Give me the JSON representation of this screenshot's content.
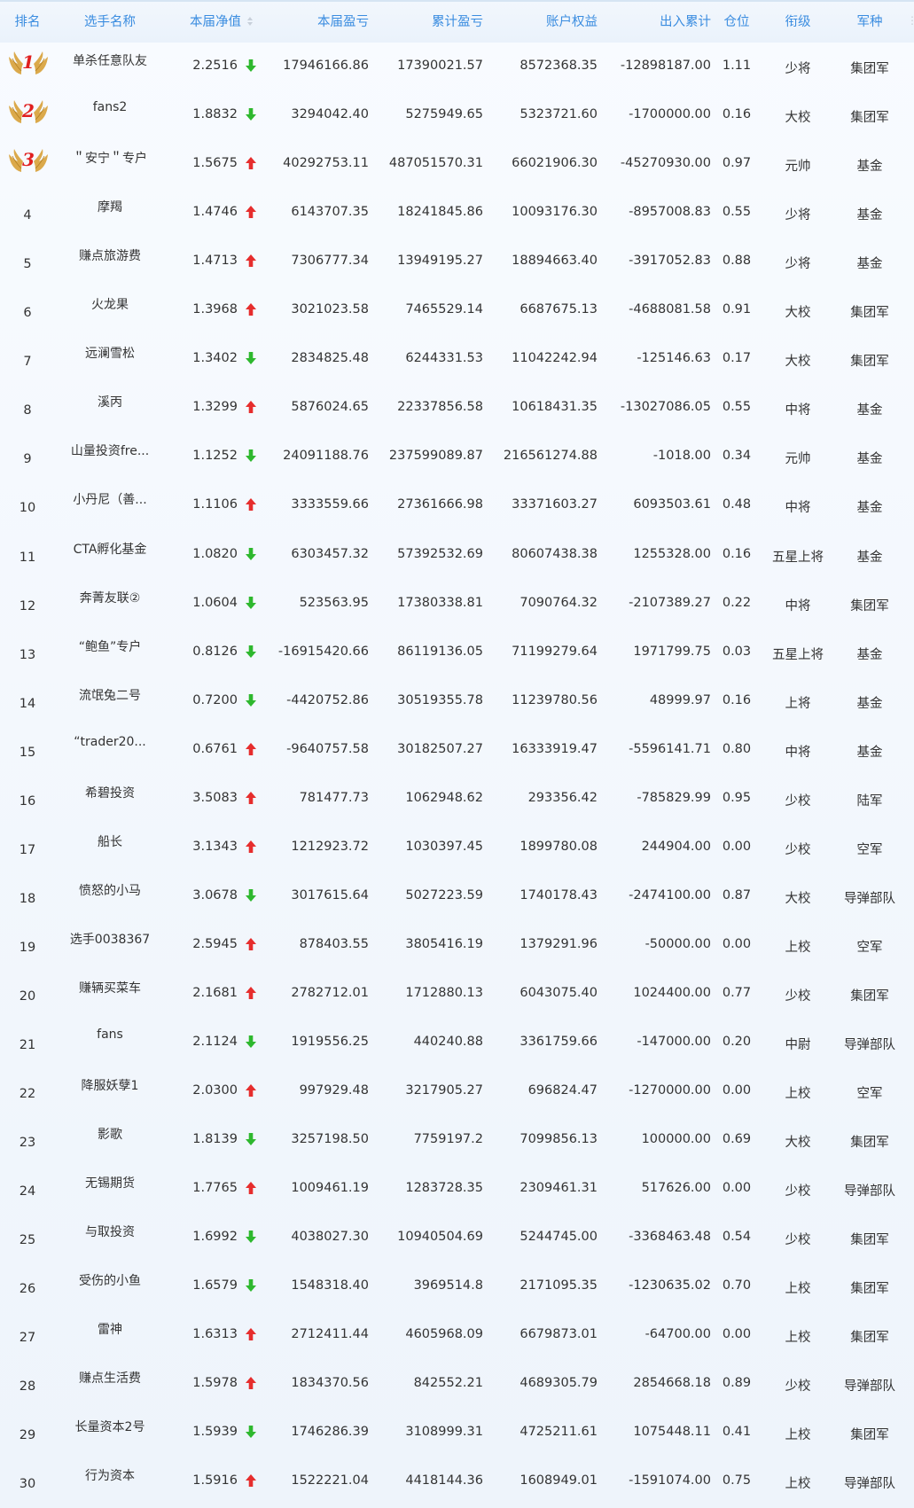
{
  "colors": {
    "header_text": "#3b8de0",
    "up": "#e62d2d",
    "down": "#2eb82e",
    "medal_num": "#e01f1f",
    "wing": "#d9a441"
  },
  "headers": [
    {
      "key": "rank",
      "label": "排名",
      "sortable": false
    },
    {
      "key": "name",
      "label": "选手名称",
      "sortable": false
    },
    {
      "key": "nav",
      "label": "本届净值",
      "sortable": true
    },
    {
      "key": "profit",
      "label": "本届盈亏",
      "sortable": false
    },
    {
      "key": "cum",
      "label": "累计盈亏",
      "sortable": false
    },
    {
      "key": "equity",
      "label": "账户权益",
      "sortable": false
    },
    {
      "key": "flow",
      "label": "出入累计",
      "sortable": false
    },
    {
      "key": "pos",
      "label": "仓位",
      "sortable": false
    },
    {
      "key": "rankname",
      "label": "衔级",
      "sortable": false
    },
    {
      "key": "army",
      "label": "军种",
      "sortable": false
    }
  ],
  "rows": [
    {
      "rank": "1",
      "medal": true,
      "name": "单杀任意队友",
      "nav": "2.2516",
      "trend": "down",
      "profit": "17946166.86",
      "cum": "17390021.57",
      "equity": "8572368.35",
      "flow": "-12898187.00",
      "pos": "1.11",
      "rankname": "少将",
      "army": "集团军"
    },
    {
      "rank": "2",
      "medal": true,
      "name": "fans2",
      "nav": "1.8832",
      "trend": "down",
      "profit": "3294042.40",
      "cum": "5275949.65",
      "equity": "5323721.60",
      "flow": "-1700000.00",
      "pos": "0.16",
      "rankname": "大校",
      "army": "集团军"
    },
    {
      "rank": "3",
      "medal": true,
      "name": "＂安宁＂专户",
      "nav": "1.5675",
      "trend": "up",
      "profit": "40292753.11",
      "cum": "487051570.31",
      "equity": "66021906.30",
      "flow": "-45270930.00",
      "pos": "0.97",
      "rankname": "元帅",
      "army": "基金"
    },
    {
      "rank": "4",
      "medal": false,
      "name": "摩羯",
      "nav": "1.4746",
      "trend": "up",
      "profit": "6143707.35",
      "cum": "18241845.86",
      "equity": "10093176.30",
      "flow": "-8957008.83",
      "pos": "0.55",
      "rankname": "少将",
      "army": "基金"
    },
    {
      "rank": "5",
      "medal": false,
      "name": "赚点旅游费",
      "nav": "1.4713",
      "trend": "up",
      "profit": "7306777.34",
      "cum": "13949195.27",
      "equity": "18894663.40",
      "flow": "-3917052.83",
      "pos": "0.88",
      "rankname": "少将",
      "army": "基金"
    },
    {
      "rank": "6",
      "medal": false,
      "name": "火龙果",
      "nav": "1.3968",
      "trend": "up",
      "profit": "3021023.58",
      "cum": "7465529.14",
      "equity": "6687675.13",
      "flow": "-4688081.58",
      "pos": "0.91",
      "rankname": "大校",
      "army": "集团军"
    },
    {
      "rank": "7",
      "medal": false,
      "name": "远澜雪松",
      "nav": "1.3402",
      "trend": "down",
      "profit": "2834825.48",
      "cum": "6244331.53",
      "equity": "11042242.94",
      "flow": "-125146.63",
      "pos": "0.17",
      "rankname": "大校",
      "army": "集团军"
    },
    {
      "rank": "8",
      "medal": false,
      "name": "溪丙",
      "nav": "1.3299",
      "trend": "up",
      "profit": "5876024.65",
      "cum": "22337856.58",
      "equity": "10618431.35",
      "flow": "-13027086.05",
      "pos": "0.55",
      "rankname": "中将",
      "army": "基金"
    },
    {
      "rank": "9",
      "medal": false,
      "name": "山量投资fre...",
      "nav": "1.1252",
      "trend": "down",
      "profit": "24091188.76",
      "cum": "237599089.87",
      "equity": "216561274.88",
      "flow": "-1018.00",
      "pos": "0.34",
      "rankname": "元帅",
      "army": "基金"
    },
    {
      "rank": "10",
      "medal": false,
      "name": "小丹尼（善...",
      "nav": "1.1106",
      "trend": "up",
      "profit": "3333559.66",
      "cum": "27361666.98",
      "equity": "33371603.27",
      "flow": "6093503.61",
      "pos": "0.48",
      "rankname": "中将",
      "army": "基金"
    },
    {
      "rank": "11",
      "medal": false,
      "name": "CTA孵化基金",
      "nav": "1.0820",
      "trend": "down",
      "profit": "6303457.32",
      "cum": "57392532.69",
      "equity": "80607438.38",
      "flow": "1255328.00",
      "pos": "0.16",
      "rankname": "五星上将",
      "army": "基金"
    },
    {
      "rank": "12",
      "medal": false,
      "name": "奔菁友联②",
      "nav": "1.0604",
      "trend": "down",
      "profit": "523563.95",
      "cum": "17380338.81",
      "equity": "7090764.32",
      "flow": "-2107389.27",
      "pos": "0.22",
      "rankname": "中将",
      "army": "集团军"
    },
    {
      "rank": "13",
      "medal": false,
      "name": "“鲍鱼”专户",
      "nav": "0.8126",
      "trend": "down",
      "profit": "-16915420.66",
      "cum": "86119136.05",
      "equity": "71199279.64",
      "flow": "1971799.75",
      "pos": "0.03",
      "rankname": "五星上将",
      "army": "基金"
    },
    {
      "rank": "14",
      "medal": false,
      "name": "流氓兔二号",
      "nav": "0.7200",
      "trend": "down",
      "profit": "-4420752.86",
      "cum": "30519355.78",
      "equity": "11239780.56",
      "flow": "48999.97",
      "pos": "0.16",
      "rankname": "上将",
      "army": "基金"
    },
    {
      "rank": "15",
      "medal": false,
      "name": "“trader20...",
      "nav": "0.6761",
      "trend": "up",
      "profit": "-9640757.58",
      "cum": "30182507.27",
      "equity": "16333919.47",
      "flow": "-5596141.71",
      "pos": "0.80",
      "rankname": "中将",
      "army": "基金"
    },
    {
      "rank": "16",
      "medal": false,
      "name": "希碧投资",
      "nav": "3.5083",
      "trend": "up",
      "profit": "781477.73",
      "cum": "1062948.62",
      "equity": "293356.42",
      "flow": "-785829.99",
      "pos": "0.95",
      "rankname": "少校",
      "army": "陆军"
    },
    {
      "rank": "17",
      "medal": false,
      "name": "船长",
      "nav": "3.1343",
      "trend": "up",
      "profit": "1212923.72",
      "cum": "1030397.45",
      "equity": "1899780.08",
      "flow": "244904.00",
      "pos": "0.00",
      "rankname": "少校",
      "army": "空军"
    },
    {
      "rank": "18",
      "medal": false,
      "name": "愤怒的小马",
      "nav": "3.0678",
      "trend": "down",
      "profit": "3017615.64",
      "cum": "5027223.59",
      "equity": "1740178.43",
      "flow": "-2474100.00",
      "pos": "0.87",
      "rankname": "大校",
      "army": "导弹部队"
    },
    {
      "rank": "19",
      "medal": false,
      "name": "选手0038367",
      "nav": "2.5945",
      "trend": "up",
      "profit": "878403.55",
      "cum": "3805416.19",
      "equity": "1379291.96",
      "flow": "-50000.00",
      "pos": "0.00",
      "rankname": "上校",
      "army": "空军"
    },
    {
      "rank": "20",
      "medal": false,
      "name": "赚辆买菜车",
      "nav": "2.1681",
      "trend": "up",
      "profit": "2782712.01",
      "cum": "1712880.13",
      "equity": "6043075.40",
      "flow": "1024400.00",
      "pos": "0.77",
      "rankname": "少校",
      "army": "集团军"
    },
    {
      "rank": "21",
      "medal": false,
      "name": "fans",
      "nav": "2.1124",
      "trend": "down",
      "profit": "1919556.25",
      "cum": "440240.88",
      "equity": "3361759.66",
      "flow": "-147000.00",
      "pos": "0.20",
      "rankname": "中尉",
      "army": "导弹部队"
    },
    {
      "rank": "22",
      "medal": false,
      "name": "降服妖孽1",
      "nav": "2.0300",
      "trend": "up",
      "profit": "997929.48",
      "cum": "3217905.27",
      "equity": "696824.47",
      "flow": "-1270000.00",
      "pos": "0.00",
      "rankname": "上校",
      "army": "空军"
    },
    {
      "rank": "23",
      "medal": false,
      "name": "影歌",
      "nav": "1.8139",
      "trend": "down",
      "profit": "3257198.50",
      "cum": "7759197.2",
      "equity": "7099856.13",
      "flow": "100000.00",
      "pos": "0.69",
      "rankname": "大校",
      "army": "集团军"
    },
    {
      "rank": "24",
      "medal": false,
      "name": "无锡期货",
      "nav": "1.7765",
      "trend": "up",
      "profit": "1009461.19",
      "cum": "1283728.35",
      "equity": "2309461.31",
      "flow": "517626.00",
      "pos": "0.00",
      "rankname": "少校",
      "army": "导弹部队"
    },
    {
      "rank": "25",
      "medal": false,
      "name": "与取投资",
      "nav": "1.6992",
      "trend": "down",
      "profit": "4038027.30",
      "cum": "10940504.69",
      "equity": "5244745.00",
      "flow": "-3368463.48",
      "pos": "0.54",
      "rankname": "少校",
      "army": "集团军"
    },
    {
      "rank": "26",
      "medal": false,
      "name": "受伤的小鱼",
      "nav": "1.6579",
      "trend": "down",
      "profit": "1548318.40",
      "cum": "3969514.8",
      "equity": "2171095.35",
      "flow": "-1230635.02",
      "pos": "0.70",
      "rankname": "上校",
      "army": "集团军"
    },
    {
      "rank": "27",
      "medal": false,
      "name": "雷神",
      "nav": "1.6313",
      "trend": "up",
      "profit": "2712411.44",
      "cum": "4605968.09",
      "equity": "6679873.01",
      "flow": "-64700.00",
      "pos": "0.00",
      "rankname": "上校",
      "army": "集团军"
    },
    {
      "rank": "28",
      "medal": false,
      "name": "赚点生活费",
      "nav": "1.5978",
      "trend": "up",
      "profit": "1834370.56",
      "cum": "842552.21",
      "equity": "4689305.79",
      "flow": "2854668.18",
      "pos": "0.89",
      "rankname": "少校",
      "army": "导弹部队"
    },
    {
      "rank": "29",
      "medal": false,
      "name": "长量资本2号",
      "nav": "1.5939",
      "trend": "down",
      "profit": "1746286.39",
      "cum": "3108999.31",
      "equity": "4725211.61",
      "flow": "1075448.11",
      "pos": "0.41",
      "rankname": "上校",
      "army": "集团军"
    },
    {
      "rank": "30",
      "medal": false,
      "name": "行为资本",
      "nav": "1.5916",
      "trend": "up",
      "profit": "1522221.04",
      "cum": "4418144.36",
      "equity": "1608949.01",
      "flow": "-1591074.00",
      "pos": "0.75",
      "rankname": "上校",
      "army": "导弹部队"
    }
  ]
}
